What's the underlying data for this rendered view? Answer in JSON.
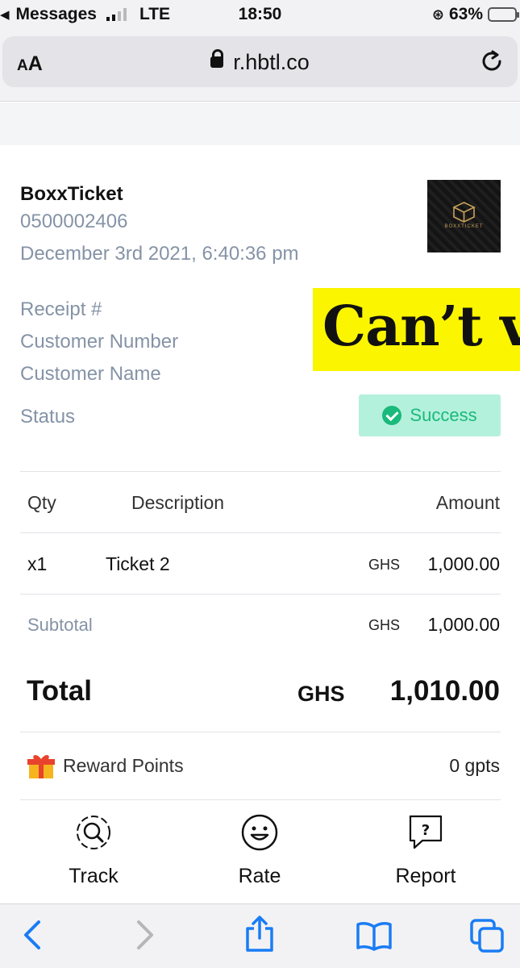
{
  "status_bar": {
    "back_app": "Messages",
    "network": "LTE",
    "time": "18:50",
    "battery": "63%",
    "battery_level": 0.63
  },
  "browser": {
    "aa_label": "AA",
    "url": "r.hbtl.co"
  },
  "receipt": {
    "merchant_name": "BoxxTicket",
    "merchant_phone": "0500002406",
    "datetime": "December 3rd 2021, 6:40:36 pm",
    "logo_text": "BOXXTICKET",
    "fields": {
      "receipt_no": "Receipt #",
      "customer_number": "Customer Number",
      "customer_name": "Customer Name",
      "status": "Status"
    },
    "overlay_text": "Can’t v",
    "status_value": "Success",
    "table": {
      "headers": {
        "qty": "Qty",
        "description": "Description",
        "amount": "Amount"
      },
      "rows": [
        {
          "qty": "x1",
          "description": "Ticket 2",
          "currency": "GHS",
          "amount": "1,000.00"
        }
      ]
    },
    "subtotal": {
      "label": "Subtotal",
      "currency": "GHS",
      "amount": "1,000.00"
    },
    "total": {
      "label": "Total",
      "currency": "GHS",
      "amount": "1,010.00"
    },
    "rewards": {
      "label": "Reward Points",
      "value": "0 gpts"
    },
    "actions": {
      "track": "Track",
      "rate": "Rate",
      "report": "Report"
    }
  },
  "colors": {
    "accent_green": "#1ab97c",
    "badge_bg": "#b4f1dc",
    "muted_text": "#8593a6",
    "ios_blue": "#1a7cf5",
    "banner_yellow": "#fbf500"
  }
}
